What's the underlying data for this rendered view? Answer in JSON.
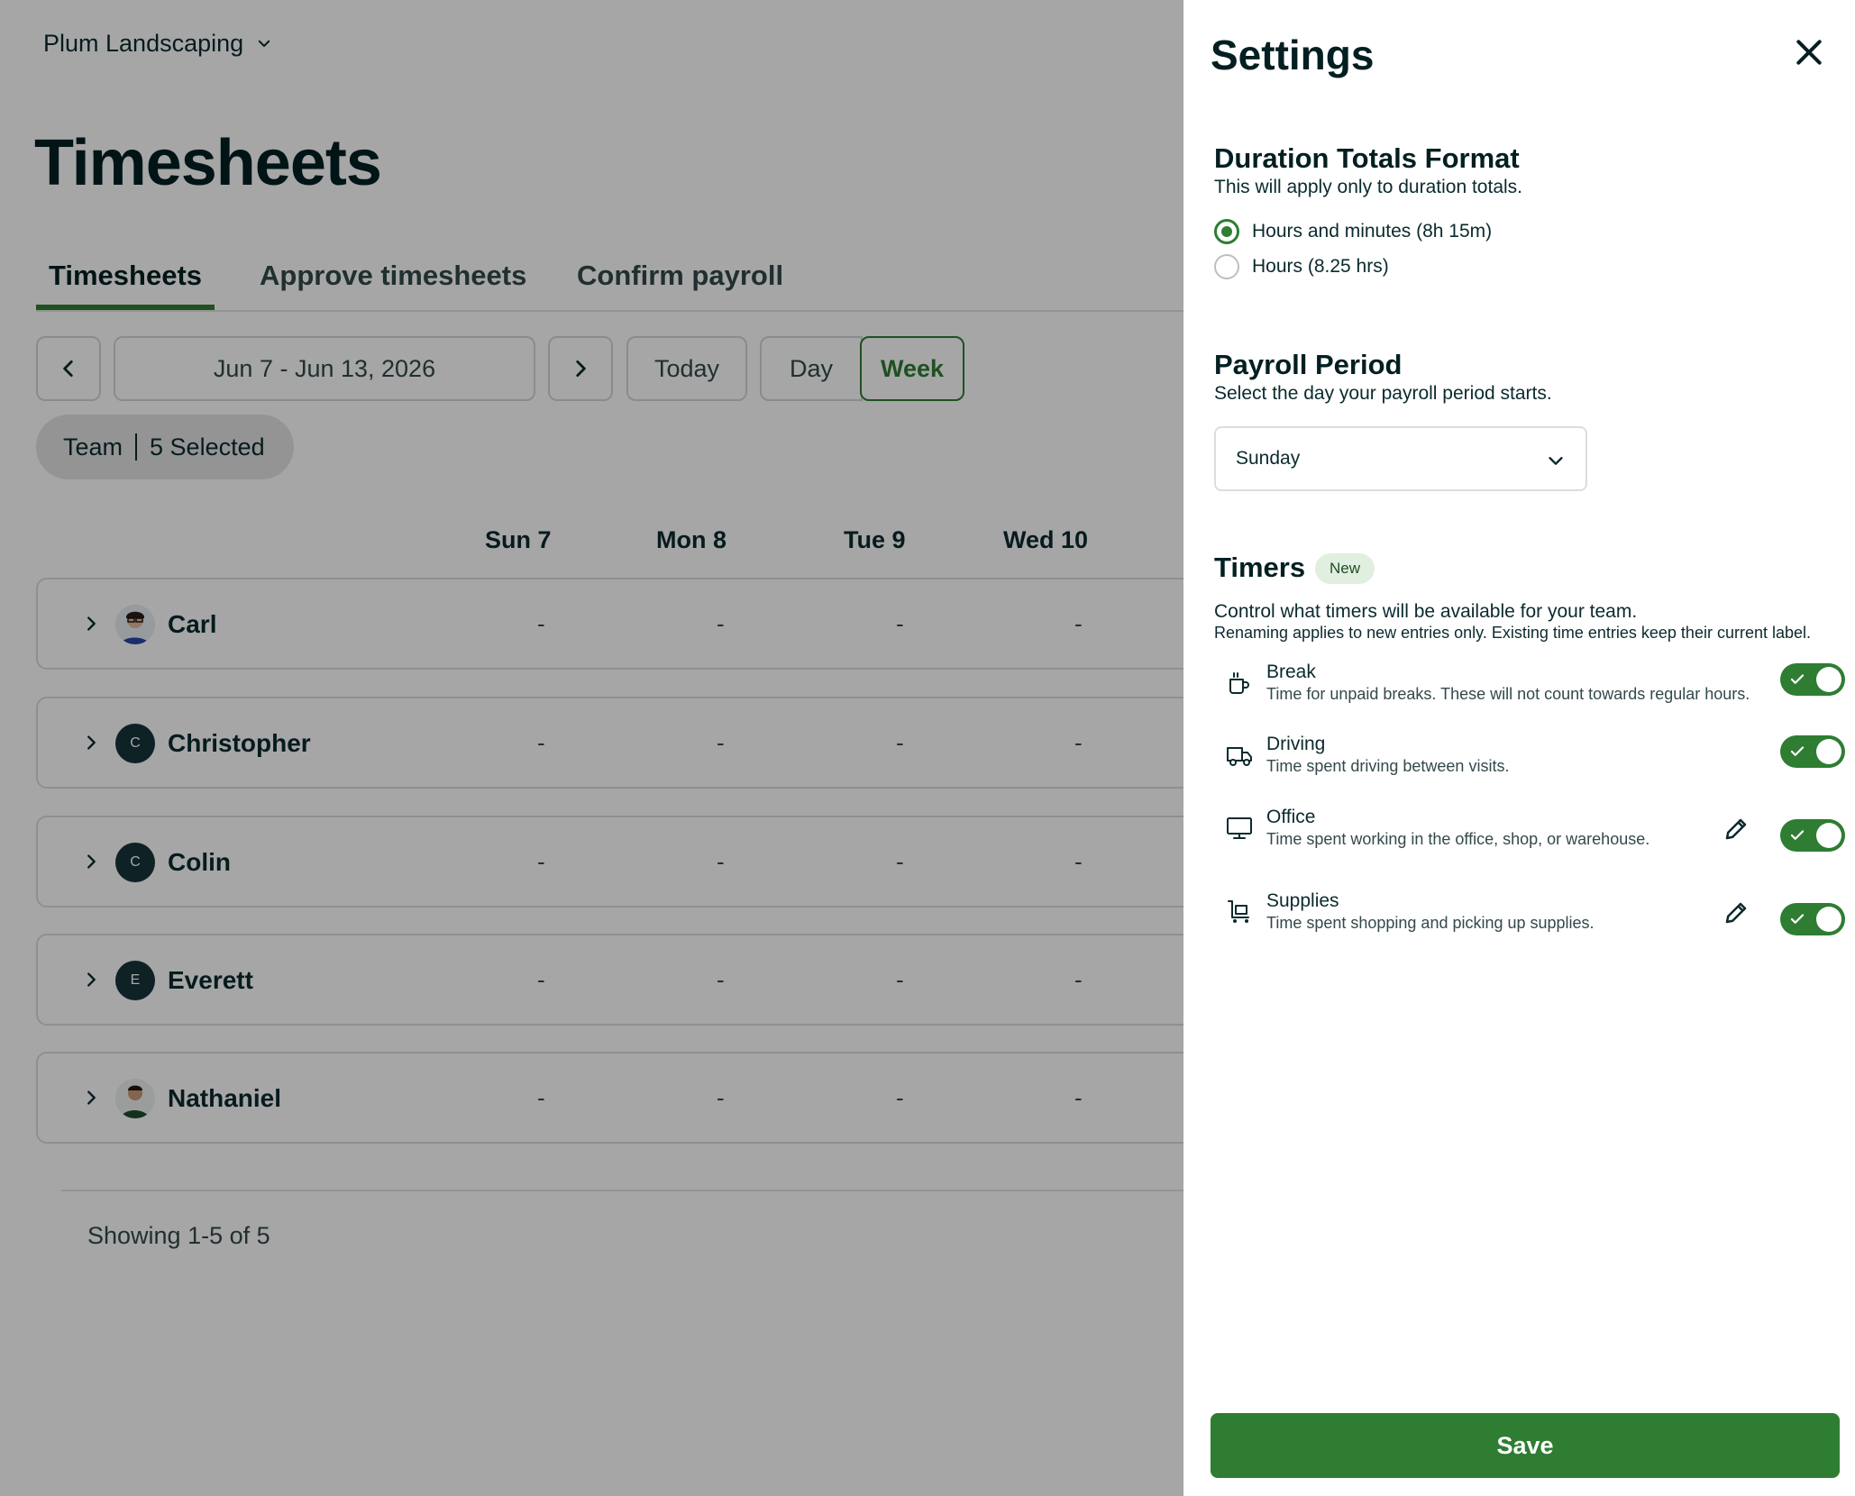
{
  "company": {
    "name": "Plum Landscaping"
  },
  "page": {
    "title": "Timesheets"
  },
  "tabs": [
    {
      "label": "Timesheets",
      "active": true
    },
    {
      "label": "Approve timesheets",
      "active": false
    },
    {
      "label": "Confirm payroll",
      "active": false
    }
  ],
  "toolbar": {
    "date_range": "Jun 7 - Jun 13, 2026",
    "today_label": "Today",
    "day_label": "Day",
    "week_label": "Week",
    "selected_view": "Week"
  },
  "team_filter": {
    "label": "Team",
    "count": "5 Selected"
  },
  "columns": [
    "Sun 7",
    "Mon 8",
    "Tue 9",
    "Wed 10"
  ],
  "rows": [
    {
      "name": "Carl",
      "initial": "",
      "avatar": "photo",
      "cells": [
        "-",
        "-",
        "-",
        "-"
      ]
    },
    {
      "name": "Christopher",
      "initial": "C",
      "avatar": "initial",
      "cells": [
        "-",
        "-",
        "-",
        "-"
      ]
    },
    {
      "name": "Colin",
      "initial": "C",
      "avatar": "initial",
      "cells": [
        "-",
        "-",
        "-",
        "-"
      ]
    },
    {
      "name": "Everett",
      "initial": "E",
      "avatar": "initial",
      "cells": [
        "-",
        "-",
        "-",
        "-"
      ]
    },
    {
      "name": "Nathaniel",
      "initial": "",
      "avatar": "photo",
      "cells": [
        "-",
        "-",
        "-",
        "-"
      ]
    }
  ],
  "pagination": {
    "text": "Showing 1-5 of 5"
  },
  "settings": {
    "title": "Settings",
    "duration": {
      "title": "Duration Totals Format",
      "subtitle": "This will apply only to duration totals.",
      "options": [
        {
          "label": "Hours and minutes (8h 15m)",
          "selected": true
        },
        {
          "label": "Hours (8.25 hrs)",
          "selected": false
        }
      ]
    },
    "payroll": {
      "title": "Payroll Period",
      "subtitle": "Select the day your payroll period starts.",
      "value": "Sunday"
    },
    "timers": {
      "title": "Timers",
      "badge": "New",
      "subtitle": "Control what timers will be available for your team.",
      "note": "Renaming applies to new entries only. Existing time entries keep their current label.",
      "items": [
        {
          "name": "Break",
          "description": "Time for unpaid breaks. These will not count towards regular hours.",
          "icon": "coffee-cup-icon",
          "enabled": true,
          "editable": false
        },
        {
          "name": "Driving",
          "description": "Time spent driving between visits.",
          "icon": "truck-icon",
          "enabled": true,
          "editable": false
        },
        {
          "name": "Office",
          "description": "Time spent working in the office, shop, or warehouse.",
          "icon": "monitor-icon",
          "enabled": true,
          "editable": true
        },
        {
          "name": "Supplies",
          "description": "Time spent shopping and picking up supplies.",
          "icon": "cart-icon",
          "enabled": true,
          "editable": true
        }
      ]
    },
    "save_label": "Save"
  },
  "colors": {
    "accent": "#2e7d32",
    "text": "#0b2a2e",
    "overlay": "rgba(0,0,0,0.35)"
  }
}
